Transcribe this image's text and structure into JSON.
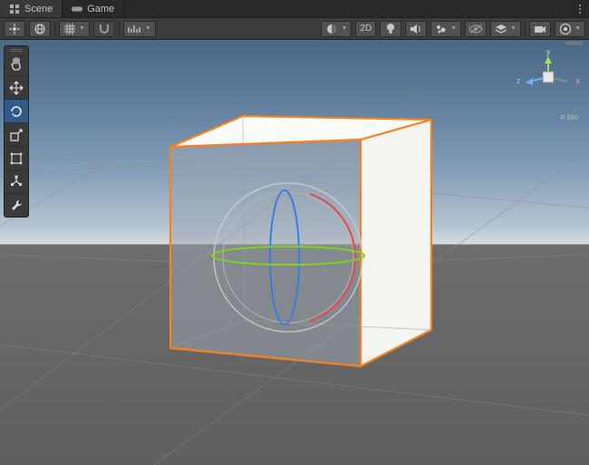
{
  "tabs": {
    "scene": "Scene",
    "game": "Game"
  },
  "toolbar": {
    "shading_mode": "Shaded",
    "mode_2d": "2D",
    "pivot_center": "Center",
    "pivot_global": "Global"
  },
  "tools": {
    "hand": "Hand Tool",
    "move": "Move Tool",
    "rotate": "Rotate Tool",
    "scale": "Scale Tool",
    "rect": "Rect Tool",
    "transform": "Transform Tool",
    "custom": "Custom Tools"
  },
  "gizmo": {
    "x": "x",
    "y": "y",
    "z": "z",
    "projection": "Iso"
  },
  "colors": {
    "selection": "#f58220",
    "axis_x": "#e24b4b",
    "axis_y": "#7ed321",
    "axis_z": "#3b7ddd"
  }
}
